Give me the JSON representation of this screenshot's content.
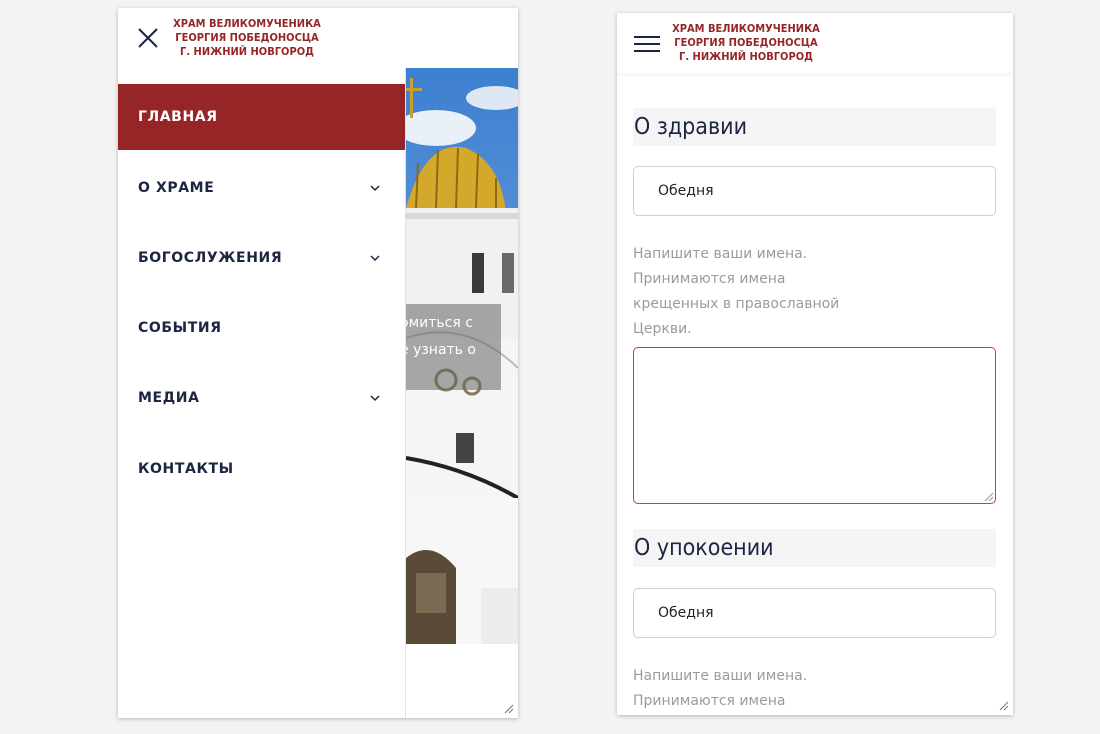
{
  "logo": {
    "line1": "ХРАМ ВЕЛИКОМУЧЕНИКА",
    "line2": "ГЕОРГИЯ ПОБЕДОНОСЦА",
    "line3": "Г. НИЖНИЙ НОВГОРОД"
  },
  "colors": {
    "brand": "#962528",
    "nav_text": "#1c2541",
    "hint_text": "#9b9b9b",
    "error_border": "#d33b3b",
    "section_bg": "#f6f5f6"
  },
  "left_screen": {
    "close_icon": "close-icon",
    "menu": [
      {
        "label": "ГЛАВНАЯ",
        "active": true,
        "has_submenu": false
      },
      {
        "label": "О ХРАМЕ",
        "active": false,
        "has_submenu": true
      },
      {
        "label": "БОГОСЛУЖЕНИЯ",
        "active": false,
        "has_submenu": true
      },
      {
        "label": "СОБЫТИЯ",
        "active": false,
        "has_submenu": false
      },
      {
        "label": "МЕДИА",
        "active": false,
        "has_submenu": true
      },
      {
        "label": "КОНТАКТЫ",
        "active": false,
        "has_submenu": false
      }
    ],
    "hero": {
      "line1": "омиться с",
      "line2": "е узнать о"
    }
  },
  "right_screen": {
    "menu_icon": "hamburger-icon",
    "health": {
      "title": "О здравии",
      "select_value": "Обедня",
      "hint": [
        "Напишите ваши имена.",
        "Принимаются имена",
        "крещенных в православной",
        "Церкви."
      ]
    },
    "repose": {
      "title": "О упокоении",
      "select_value": "Обедня",
      "hint": [
        "Напишите ваши имена.",
        "Принимаются имена"
      ]
    }
  }
}
